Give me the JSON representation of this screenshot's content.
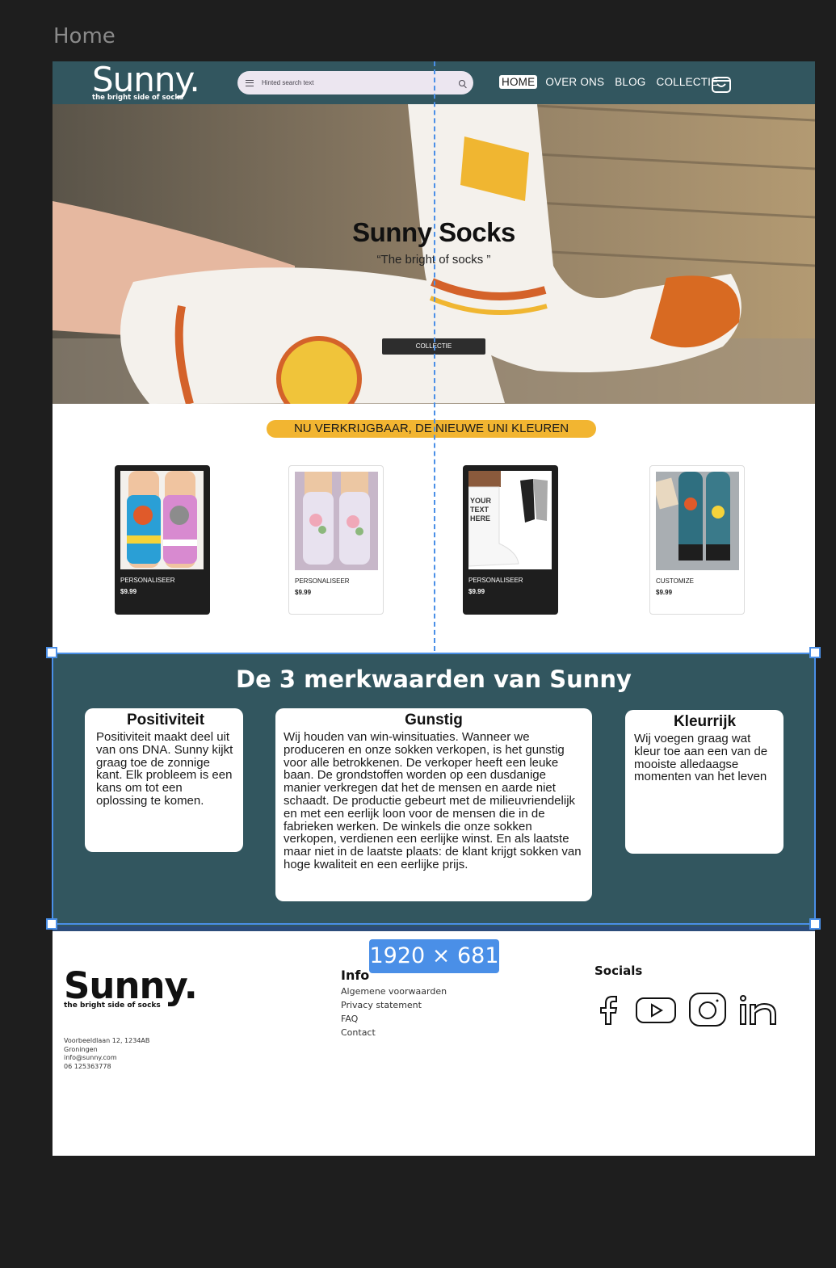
{
  "frame": {
    "label": "Home"
  },
  "header": {
    "logo_word": "Sunny.",
    "logo_tagline": "the bright side of socks",
    "search_placeholder": "Hinted search text",
    "nav": [
      {
        "label": "HOME",
        "active": true
      },
      {
        "label": "OVER ONS",
        "active": false
      },
      {
        "label": "BLOG",
        "active": false
      },
      {
        "label": "COLLECTIE",
        "active": false
      }
    ],
    "cart_icon": "shopping-bag-icon"
  },
  "hero": {
    "title": "Sunny Socks",
    "subtitle": "“The bright of socks ”",
    "button": "COLLECTIE"
  },
  "products": {
    "banner": "NU VERKRIJGBAAR, DE NIEUWE UNI KLEUREN",
    "items": [
      {
        "label": "PERSONALISEER",
        "price": "$9.99",
        "theme": "dark"
      },
      {
        "label": "PERSONALISEER",
        "price": "$9.99",
        "theme": "light"
      },
      {
        "label": "PERSONALISEER",
        "price": "$9.99",
        "theme": "dark",
        "image_text": "YOUR TEXT HERE"
      },
      {
        "label": "CUSTOMIZE",
        "price": "$9.99",
        "theme": "light"
      }
    ]
  },
  "values": {
    "title": "De 3 merkwaarden van Sunny",
    "cards": [
      {
        "title": "Positiviteit",
        "body": "Positiviteit maakt deel uit van ons DNA. Sunny kijkt graag toe de zonnige kant. Elk probleem is een kans om tot een oplossing te komen."
      },
      {
        "title": "Gunstig",
        "body": "Wij houden van win-winsituaties. Wanneer we produceren en onze sokken verkopen, is het gunstig voor alle betrokkenen. De verkoper heeft een leuke baan. De grondstoffen worden op een dusdanige manier verkregen dat het de mensen en aarde niet schaadt. De productie gebeurt met de milieuvriendelijk en met een eerlijk loon voor de mensen die in de fabrieken werken. De winkels die onze sokken verkopen, verdienen een eerlijke winst. En als laatste maar niet in de laatste plaats: de klant krijgt sokken van hoge kwaliteit en een eerlijke prijs."
      },
      {
        "title": "Kleurrijk",
        "body": "Wij voegen graag wat kleur toe aan een van de mooiste alledaagse momenten van het leven"
      }
    ]
  },
  "footer": {
    "logo_word": "Sunny.",
    "logo_tagline": "the bright side of socks",
    "address": [
      "Voorbeeldlaan 12, 1234AB",
      "Groningen",
      "info@sunny.com",
      "06 125363778"
    ],
    "info_title": "Info",
    "info_links": [
      "Algemene voorwaarden",
      "Privacy statement",
      "FAQ",
      "Contact"
    ],
    "socials_title": "Socials",
    "socials": [
      "facebook-icon",
      "youtube-icon",
      "instagram-icon",
      "linkedin-icon"
    ]
  },
  "selection": {
    "dimensions": "1920 × 681"
  },
  "colors": {
    "header": "#32565f",
    "accent": "#f2b531",
    "selection": "#4a8fe7"
  }
}
